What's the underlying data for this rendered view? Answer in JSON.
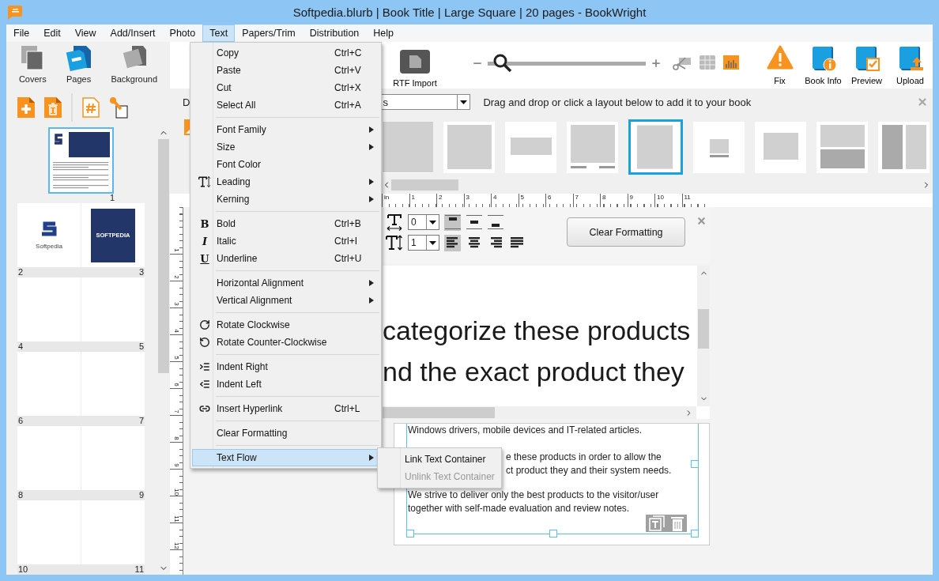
{
  "window": {
    "title": "Softpedia.blurb | Book Title | Large Square | 20 pages - BookWright"
  },
  "menubar": [
    {
      "label": "File",
      "selected": false
    },
    {
      "label": "Edit",
      "selected": false
    },
    {
      "label": "View",
      "selected": false
    },
    {
      "label": "Add/Insert",
      "selected": false
    },
    {
      "label": "Photo",
      "selected": false
    },
    {
      "label": "Text",
      "selected": true
    },
    {
      "label": "Papers/Trim",
      "selected": false
    },
    {
      "label": "Distribution",
      "selected": false
    },
    {
      "label": "Help",
      "selected": false
    }
  ],
  "sidebar": {
    "tools": [
      {
        "label": "Covers",
        "kind": "covers"
      },
      {
        "label": "Pages",
        "kind": "pages"
      },
      {
        "label": "Background",
        "kind": "background"
      }
    ],
    "thumbnails": [
      {
        "selected": true,
        "pages": [
          {
            "number": "1",
            "kind": "cover"
          }
        ]
      },
      {
        "selected": false,
        "pages": [
          {
            "number": "2",
            "kind": "logo",
            "caption": "Softpedia"
          },
          {
            "number": "3",
            "kind": "banner",
            "caption": "SOFTPEDIA"
          }
        ]
      },
      {
        "selected": false,
        "pages": [
          {
            "number": "4",
            "kind": "blank"
          },
          {
            "number": "5",
            "kind": "blank"
          }
        ]
      },
      {
        "selected": false,
        "pages": [
          {
            "number": "6",
            "kind": "blank"
          },
          {
            "number": "7",
            "kind": "blank"
          }
        ]
      },
      {
        "selected": false,
        "pages": [
          {
            "number": "8",
            "kind": "blank"
          },
          {
            "number": "9",
            "kind": "blank"
          }
        ]
      },
      {
        "selected": false,
        "pages": [
          {
            "number": "10",
            "kind": "blank"
          },
          {
            "number": "11",
            "kind": "blank"
          }
        ]
      }
    ]
  },
  "toolbar": {
    "rtf_import": "RTF Import",
    "zoom": {
      "level": 0.04
    },
    "actions": [
      {
        "label": "Fix",
        "kind": "fix"
      },
      {
        "label": "Book Info",
        "kind": "info"
      },
      {
        "label": "Preview",
        "kind": "preview"
      },
      {
        "label": "Upload",
        "kind": "upload"
      }
    ]
  },
  "layout_bar": {
    "label": "D",
    "dropdown_value": "s",
    "hint": "Drag and drop or click a layout below to add it to your book",
    "layouts": [
      {
        "kind": "full",
        "selected": false
      },
      {
        "kind": "inset",
        "selected": false
      },
      {
        "kind": "banner",
        "selected": false
      },
      {
        "kind": "captioned",
        "selected": false
      },
      {
        "kind": "portrait",
        "selected": true
      },
      {
        "kind": "small-captioned",
        "selected": false
      },
      {
        "kind": "landscape",
        "selected": false
      },
      {
        "kind": "stacked",
        "selected": false
      },
      {
        "kind": "columns",
        "selected": false
      }
    ]
  },
  "ruler": {
    "horizontal": [
      "in",
      "1",
      "2",
      "3",
      "4",
      "5",
      "6",
      "7",
      "8",
      "9",
      "10",
      "11"
    ],
    "vertical": [
      "1",
      "2",
      "3",
      "4",
      "5",
      "6",
      "7",
      "8",
      "9",
      "10",
      "11",
      "12"
    ]
  },
  "format_bar": {
    "tracking": "0",
    "leading": "1",
    "vertical_align": [
      {
        "kind": "top",
        "selected": true
      },
      {
        "kind": "middle",
        "selected": false
      },
      {
        "kind": "bottom",
        "selected": false
      }
    ],
    "horizontal_align": [
      {
        "kind": "left",
        "selected": true
      },
      {
        "kind": "center",
        "selected": false
      },
      {
        "kind": "right",
        "selected": false
      },
      {
        "kind": "justify",
        "selected": false
      }
    ],
    "clear_button": "Clear Formatting"
  },
  "preview": {
    "lines": [
      "categorize these products",
      "nd the exact product they"
    ]
  },
  "page": {
    "first_line": "Windows drivers, mobile devices and IT-related articles.",
    "partial_lines": [
      "e these products in order to allow the",
      "ct product they and their system needs."
    ],
    "paragraph": "We strive to deliver only the best products to the visitor/user together with self-made evaluation and review notes."
  },
  "text_menu": {
    "groups": [
      [
        {
          "label": "Copy",
          "kind": "plain",
          "shortcut": "Ctrl+C",
          "submenu": false,
          "selected": false
        },
        {
          "label": "Paste",
          "kind": "plain",
          "shortcut": "Ctrl+V",
          "submenu": false,
          "selected": false
        },
        {
          "label": "Cut",
          "kind": "plain",
          "shortcut": "Ctrl+X",
          "submenu": false,
          "selected": false
        },
        {
          "label": "Select All",
          "kind": "plain",
          "shortcut": "Ctrl+A",
          "submenu": false,
          "selected": false
        }
      ],
      [
        {
          "label": "Font Family",
          "kind": "plain",
          "submenu": true,
          "selected": false
        },
        {
          "label": "Size",
          "kind": "plain",
          "submenu": true,
          "selected": false
        },
        {
          "label": "Font Color",
          "kind": "plain",
          "submenu": false,
          "selected": false
        },
        {
          "label": "Leading",
          "kind": "leading",
          "submenu": true,
          "selected": false
        },
        {
          "label": "Kerning",
          "kind": "plain",
          "submenu": true,
          "selected": false
        }
      ],
      [
        {
          "label": "Bold",
          "kind": "glyph",
          "glyph": "B",
          "shortcut": "Ctrl+B",
          "submenu": false,
          "selected": false
        },
        {
          "label": "Italic",
          "kind": "glyph",
          "glyph": "I",
          "shortcut": "Ctrl+I",
          "submenu": false,
          "selected": false
        },
        {
          "label": "Underline",
          "kind": "glyph",
          "glyph": "U",
          "shortcut": "Ctrl+U",
          "submenu": false,
          "selected": false
        }
      ],
      [
        {
          "label": "Horizontal Alignment",
          "kind": "plain",
          "submenu": true,
          "selected": false
        },
        {
          "label": "Vertical Alignment",
          "kind": "plain",
          "submenu": true,
          "selected": false
        }
      ],
      [
        {
          "label": "Rotate Clockwise",
          "kind": "rotate-cw",
          "submenu": false,
          "selected": false
        },
        {
          "label": "Rotate Counter-Clockwise",
          "kind": "rotate-ccw",
          "submenu": false,
          "selected": false
        }
      ],
      [
        {
          "label": "Indent Right",
          "kind": "indent-right",
          "submenu": false,
          "selected": false
        },
        {
          "label": "Indent Left",
          "kind": "indent-left",
          "submenu": false,
          "selected": false
        }
      ],
      [
        {
          "label": "Insert Hyperlink",
          "kind": "link",
          "shortcut": "Ctrl+L",
          "submenu": false,
          "selected": false
        }
      ],
      [
        {
          "label": "Clear Formatting",
          "kind": "plain",
          "submenu": false,
          "selected": false
        }
      ],
      [
        {
          "label": "Text Flow",
          "kind": "plain",
          "submenu": true,
          "selected": true
        }
      ]
    ]
  },
  "text_flow_submenu": [
    {
      "label": "Link Text Container",
      "disabled": false
    },
    {
      "label": "Unlink Text Container",
      "disabled": true
    }
  ]
}
